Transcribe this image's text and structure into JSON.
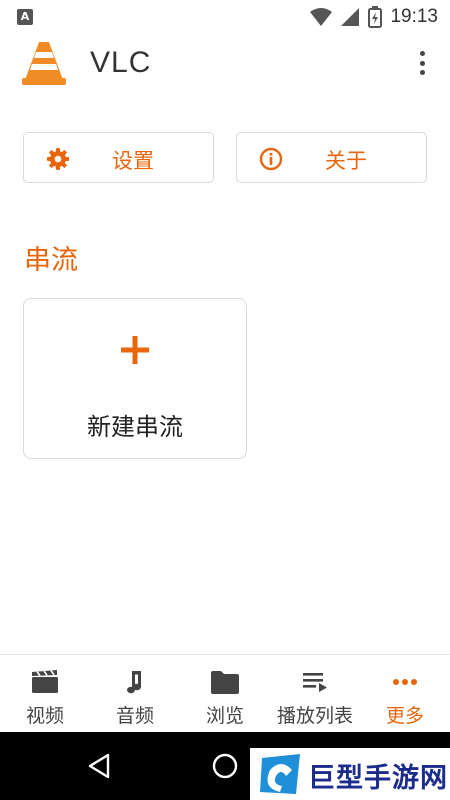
{
  "status_bar": {
    "time": "19:13",
    "notification": "A"
  },
  "app_bar": {
    "title": "VLC"
  },
  "buttons": {
    "settings": "设置",
    "about": "关于"
  },
  "section": {
    "title": "串流"
  },
  "stream_card": {
    "label": "新建串流"
  },
  "bottom_nav": {
    "items": [
      {
        "label": "视频",
        "icon": "video-icon",
        "active": false
      },
      {
        "label": "音频",
        "icon": "music-icon",
        "active": false
      },
      {
        "label": "浏览",
        "icon": "folder-icon",
        "active": false
      },
      {
        "label": "播放列表",
        "icon": "playlist-icon",
        "active": false
      },
      {
        "label": "更多",
        "icon": "more-icon",
        "active": true
      }
    ]
  },
  "watermark": {
    "text": "巨型手游网"
  },
  "colors": {
    "accent": "#e8650b",
    "text": "#333333",
    "border": "#dadada"
  }
}
